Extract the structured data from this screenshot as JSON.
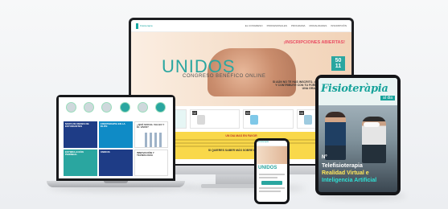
{
  "desktop": {
    "logo_text": "Fisioterapia",
    "nav_links": [
      "EL CONGRESO",
      "PROFESIONALES",
      "PROGRAMA",
      "MODALIDADES",
      "INSCRIPCIÓN"
    ],
    "headline": "UNIDOS",
    "subheadline": "CONGRESO BENÉFICO ONLINE",
    "banner": "¡INSCRIPCIONES ABIERTAS!",
    "dates": [
      "50",
      "11"
    ],
    "cta": "SI AÚN NO TE HAS INSCRITO, ¡HAZLO YA Y CONTRIBUYE CON TU FORMACIÓN A UNA GRAN CAUSA!",
    "cards": [
      "01",
      "02",
      "03",
      "04"
    ],
    "band_title": "UN DIA MAS EN FAVOR",
    "band_link": "SI QUIERES SABER MÁS SOBRE EL CONGRESO"
  },
  "laptop": {
    "tiles": [
      "MAPA DE REDES DE ESTUDIANTES",
      "FISIOTERAPIA EN LA ÉLITE",
      "¿QUÉ SON EL VALGO Y EL VARO?",
      "ESTIMULACIÓN PERINEAL",
      "UNIDOS",
      "INNOVACIÓN Y TECNOLOGÍA"
    ]
  },
  "tablet": {
    "title": "Fisioteràpia",
    "subtitle": "al dia",
    "issue": "Nº",
    "headline_1": "Telefisioterapia",
    "headline_2": "Realidad Virtual e",
    "headline_3": "Inteligencia Artificial"
  },
  "phone": {
    "logo_text": "Fisioterapia",
    "headline": "UNIDOS"
  },
  "colors": {
    "teal": "#2aa6a0",
    "yellow": "#f9d84a",
    "navy": "#1e3c86",
    "pink": "#e94e64"
  }
}
